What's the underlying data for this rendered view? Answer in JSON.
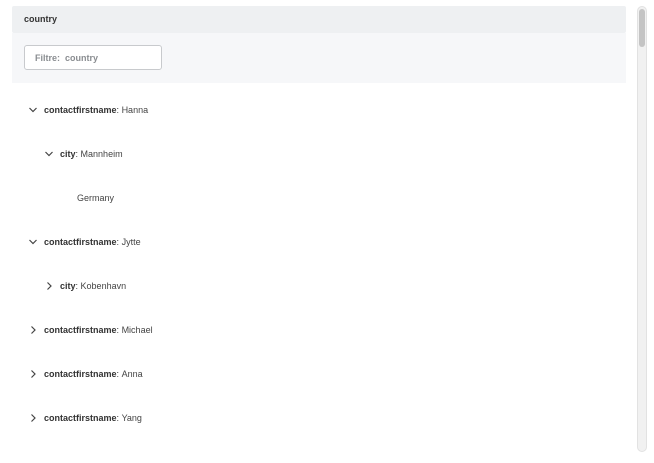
{
  "header": {
    "title": "country"
  },
  "filter": {
    "placeholder": "Filtre:  country"
  },
  "tree": {
    "r0": {
      "key": "contactfirstname",
      "value": "Hanna"
    },
    "r1": {
      "key": "city",
      "value": "Mannheim"
    },
    "r2": {
      "text": "Germany"
    },
    "r3": {
      "key": "contactfirstname",
      "value": "Jytte"
    },
    "r4": {
      "key": "city",
      "value": "Kobenhavn"
    },
    "r5": {
      "key": "contactfirstname",
      "value": "Michael"
    },
    "r6": {
      "key": "contactfirstname",
      "value": "Anna"
    },
    "r7": {
      "key": "contactfirstname",
      "value": "Yang"
    }
  },
  "separator": ":",
  "icons": {
    "expanded": "chevron-down-icon",
    "collapsed": "chevron-right-icon"
  }
}
